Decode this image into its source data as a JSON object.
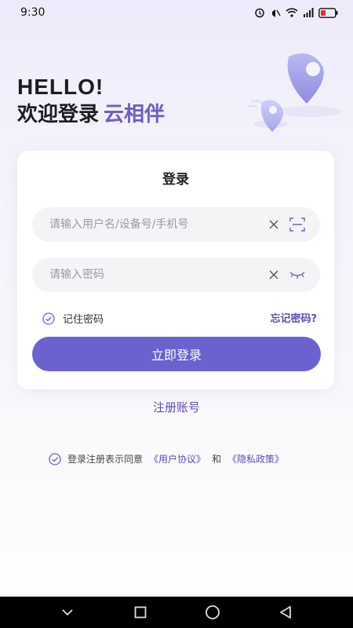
{
  "status_bar": {
    "time": "9:30",
    "icons": [
      "alarm-icon",
      "mute-icon",
      "wifi-icon",
      "signal-4g-icon",
      "battery-icon"
    ]
  },
  "hero": {
    "hello": "HELLO!",
    "welcome": "欢迎登录",
    "brand": "云相伴"
  },
  "login_card": {
    "title": "登录",
    "username_placeholder": "请输入用户名/设备号/手机号",
    "password_placeholder": "请输入密码",
    "remember_label": "记住密码",
    "remember_checked": true,
    "forgot_label": "忘记密码?",
    "submit_label": "立即登录"
  },
  "register_label": "注册账号",
  "agreement": {
    "prefix": "登录注册表示同意",
    "user_agreement": "《用户协议》",
    "and": "和",
    "privacy_policy": "《隐私政策》",
    "checked": true
  },
  "nav_bar": {
    "buttons": [
      "chevron-down-icon",
      "square-icon",
      "circle-icon",
      "triangle-back-icon"
    ]
  },
  "colors": {
    "accent": "#6b62d0",
    "link": "#5a4fb8",
    "brand_text": "#6b5fc7",
    "field_bg": "#f4f4f7"
  }
}
